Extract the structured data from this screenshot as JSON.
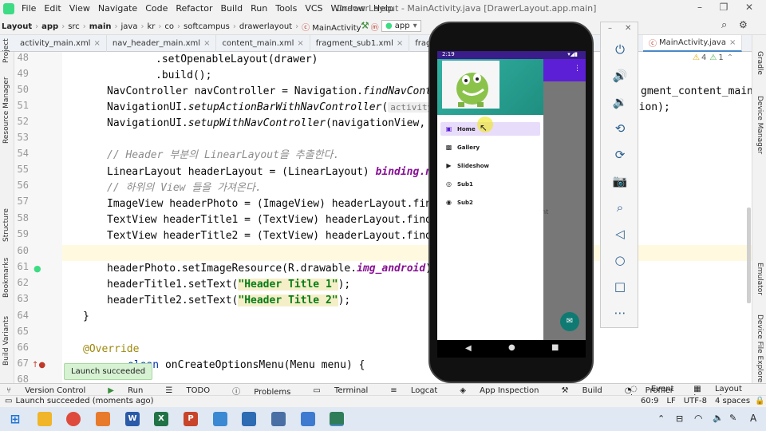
{
  "titlebar": {
    "menu": [
      "File",
      "Edit",
      "View",
      "Navigate",
      "Code",
      "Refactor",
      "Build",
      "Run",
      "Tools",
      "VCS",
      "Window",
      "Help"
    ],
    "title": "DrawerLayout - MainActivity.java [DrawerLayout.app.main]"
  },
  "navbar": {
    "crumbs": [
      "Layout",
      "app",
      "src",
      "main",
      "java",
      "kr",
      "co",
      "softcampus",
      "drawerlayout",
      "MainActivity",
      "onCreate"
    ],
    "run_config": "app",
    "tab_right": "MainActivity.java"
  },
  "tabs": [
    "activity_main.xml",
    "nav_header_main.xml",
    "content_main.xml",
    "fragment_sub1.xml",
    "fragment_sub2"
  ],
  "inspections": {
    "warnings": "4",
    "info": "1"
  },
  "left_strip": [
    "Project",
    "Resource Manager",
    "Structure",
    "Bookmarks",
    "Build Variants"
  ],
  "right_strip": [
    "Gradle",
    "Device Manager",
    "Emulator",
    "Device File Explorer"
  ],
  "line_numbers": [
    "48",
    "49",
    "50",
    "51",
    "52",
    "53",
    "54",
    "55",
    "56",
    "57",
    "58",
    "59",
    "60",
    "61",
    "62",
    "63",
    "64",
    "65",
    "66",
    "67",
    "68"
  ],
  "code": {
    "l48": ".setOpenableLayout(drawer)",
    "l49": ".build();",
    "l50a": "NavController navController = Navigation.",
    "l50b": "findNavContro",
    "l50c": "gment_content_main);",
    "l51a": "NavigationUI.",
    "l51b": "setupActionBarWithNavController",
    "l51c": "(",
    "l51hint": "activity:",
    "l51d": " th",
    "l51e": "ction);",
    "l52a": "NavigationUI.",
    "l52b": "setupWithNavController",
    "l52c": "(navigationView, na",
    "l54": "// Header 부분의 LinearLayout을 추출한다.",
    "l55a": "LinearLayout headerLayout = (LinearLayout) ",
    "l55b": "binding.nav",
    "l56": "// 하위의 View 들을 가져온다.",
    "l57": "ImageView headerPhoto = (ImageView) headerLayout.findV",
    "l58": "TextView headerTitle1 = (TextView) headerLayout.findVi",
    "l59": "TextView headerTitle2 = (TextView) headerLayout.findVi",
    "l61a": "headerPhoto.setImageResource(R.drawable.",
    "l61b": "img_android",
    "l61c": ");",
    "l62a": "headerTitle1.setText(",
    "l62b": "\"Header Title 1\"",
    "l62c": ");",
    "l63a": "headerTitle2.setText(",
    "l63b": "\"Header Title 2\"",
    "l63c": ");",
    "l64": "}",
    "l66": "@Override",
    "l67a": "olean",
    "l67b": " onCreateOptionsMenu(Menu menu) {"
  },
  "toast": "Launch succeeded",
  "bottom_tools": [
    "Version Control",
    "Run",
    "TODO",
    "Problems",
    "Terminal",
    "Logcat",
    "App Inspection",
    "Build",
    "Profiler",
    "Event Log",
    "Layout Inspector"
  ],
  "status": {
    "message": "Launch succeeded (moments ago)",
    "position": "60:9",
    "line_sep": "LF",
    "encoding": "UTF-8",
    "indent": "4 spaces"
  },
  "phone": {
    "time": "2:19",
    "drawer_items": [
      "Home",
      "Gallery",
      "Slideshow",
      "Sub1",
      "Sub2"
    ],
    "content_fragment": "nt"
  },
  "taskbar": {
    "ime": "A"
  },
  "colors": {
    "accent": "#5c1fd6",
    "drawer_header": "#32b3a3",
    "selected_item": "#e8dcfb",
    "fab": "#0f7a72",
    "keyword": "#0033b3",
    "string": "#067d17"
  }
}
